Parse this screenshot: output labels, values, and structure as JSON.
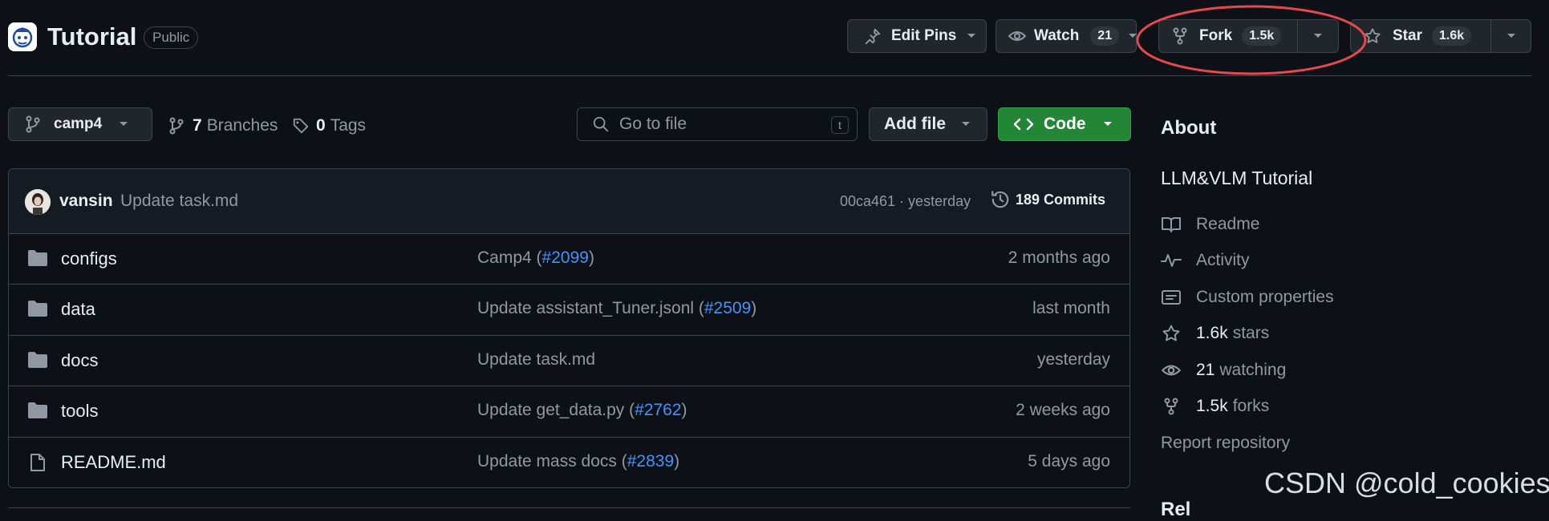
{
  "repo": {
    "name": "Tutorial",
    "visibility": "Public"
  },
  "header_actions": {
    "edit_pins": "Edit Pins",
    "watch": "Watch",
    "watch_count": "21",
    "fork": "Fork",
    "fork_count": "1.5k",
    "star": "Star",
    "star_count": "1.6k"
  },
  "toolbar": {
    "branch": "camp4",
    "branches_count": "7",
    "branches_label": "Branches",
    "tags_count": "0",
    "tags_label": "Tags",
    "search_placeholder": "Go to file",
    "search_shortcut": "t",
    "add_file": "Add file",
    "code": "Code"
  },
  "latest_commit": {
    "author": "vansin",
    "message": "Update task.md",
    "meta": "00ca461 · yesterday",
    "commits_count": "189 Commits"
  },
  "files": [
    {
      "name": "configs",
      "type": "folder",
      "msg_text": "Camp4 (",
      "msg_link": "#2099",
      "msg_end": ")",
      "time": "2 months ago"
    },
    {
      "name": "data",
      "type": "folder",
      "msg_text": "Update assistant_Tuner.jsonl (",
      "msg_link": "#2509",
      "msg_end": ")",
      "time": "last month"
    },
    {
      "name": "docs",
      "type": "folder",
      "msg_text": "Update task.md",
      "msg_link": "",
      "msg_end": "",
      "time": "yesterday"
    },
    {
      "name": "tools",
      "type": "folder",
      "msg_text": "Update get_data.py (",
      "msg_link": "#2762",
      "msg_end": ")",
      "time": "2 weeks ago"
    },
    {
      "name": "README.md",
      "type": "file",
      "msg_text": "Update mass docs (",
      "msg_link": "#2839",
      "msg_end": ")",
      "time": "5 days ago"
    }
  ],
  "about": {
    "heading": "About",
    "description": "LLM&VLM Tutorial",
    "readme": "Readme",
    "activity": "Activity",
    "custom_properties": "Custom properties",
    "stars_count": "1.6k",
    "stars_label": "stars",
    "watching_count": "21",
    "watching_label": "watching",
    "forks_count": "1.5k",
    "forks_label": "forks",
    "report": "Report repository",
    "next_heading_partial": "Rel"
  },
  "watermark": "CSDN @cold_cookies",
  "colors": {
    "background": "#0d1117",
    "code_button": "#238636",
    "link": "#4493f8",
    "annotation_ellipse": "#e5484d"
  }
}
